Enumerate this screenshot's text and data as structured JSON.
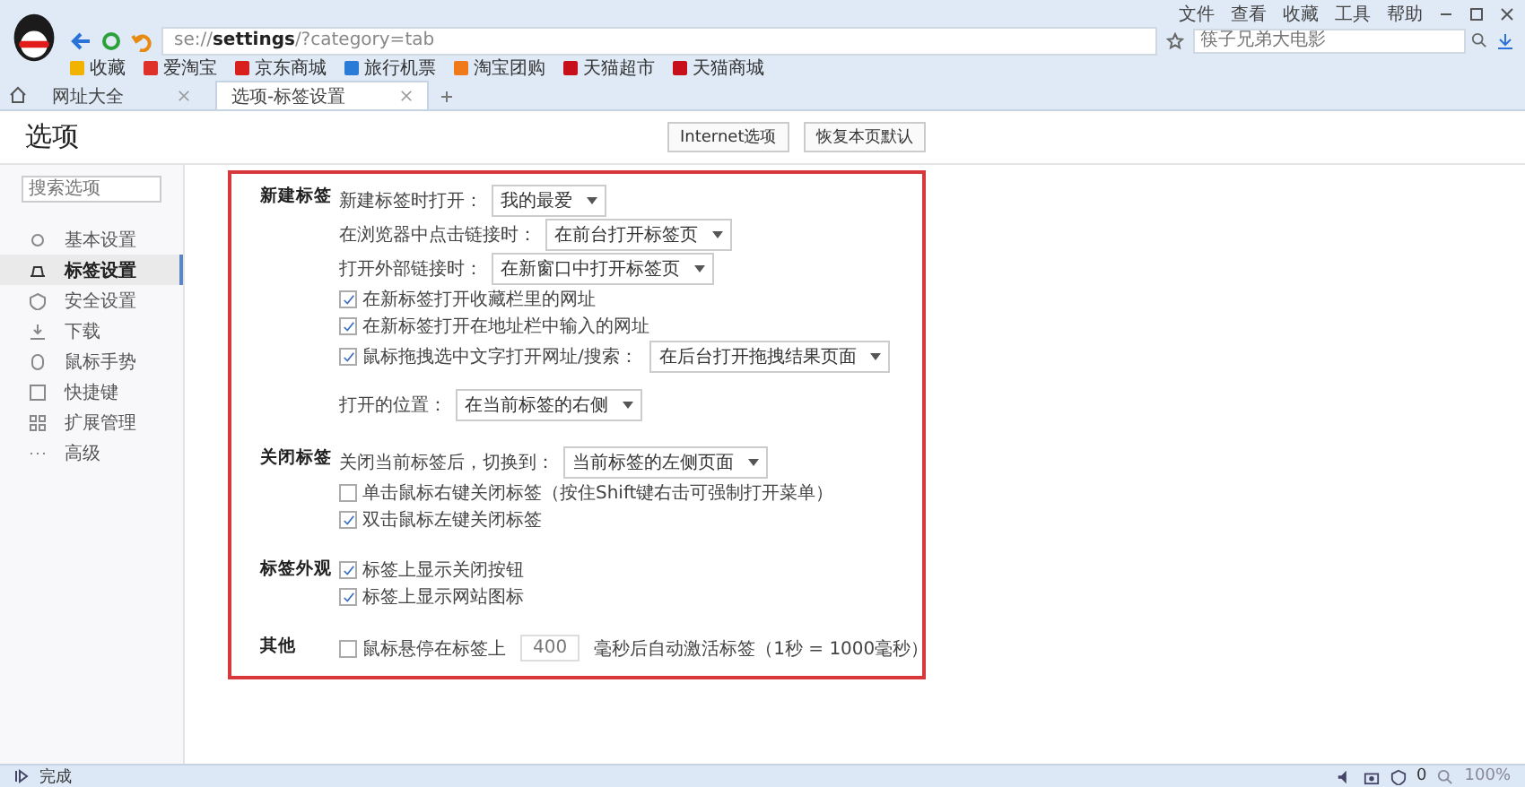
{
  "browser": {
    "menu": [
      "文件",
      "查看",
      "收藏",
      "工具",
      "帮助"
    ],
    "address": "se://**settings**/?category=tab",
    "search": {
      "placeholder": "筷子兄弟大电影"
    },
    "bookmarks": [
      {
        "label": "收藏",
        "color": "#f2b200"
      },
      {
        "label": "爱淘宝",
        "color": "#e0302a"
      },
      {
        "label": "京东商城",
        "color": "#d8201c"
      },
      {
        "label": "旅行机票",
        "color": "#2a7ad8"
      },
      {
        "label": "淘宝团购",
        "color": "#f07a1a"
      },
      {
        "label": "天猫超市",
        "color": "#c8101a"
      },
      {
        "label": "天猫商城",
        "color": "#c8101a"
      }
    ],
    "tabs": [
      {
        "label": "网址大全",
        "selected": false
      },
      {
        "label": "选项-标签设置",
        "selected": true
      }
    ]
  },
  "page": {
    "title": "选项",
    "buttons": [
      "Internet选项",
      "恢复本页默认"
    ],
    "sidebar": {
      "search": {
        "placeholder": "搜索选项"
      },
      "items": [
        {
          "label": "基本设置",
          "selected": false
        },
        {
          "label": "标签设置",
          "selected": true
        },
        {
          "label": "安全设置",
          "selected": false
        },
        {
          "label": "下载",
          "selected": false
        },
        {
          "label": "鼠标手势",
          "selected": false
        },
        {
          "label": "快捷键",
          "selected": false
        },
        {
          "label": "扩展管理",
          "selected": false
        },
        {
          "label": "高级",
          "selected": false
        }
      ]
    },
    "sections": [
      {
        "title": "新建标签",
        "rows": [
          {
            "kind": "select",
            "label": "新建标签时打开：",
            "value": "我的最爱"
          },
          {
            "kind": "select",
            "label": "在浏览器中点击链接时：",
            "value": "在前台打开标签页"
          },
          {
            "kind": "select",
            "label": "打开外部链接时：",
            "value": "在新窗口中打开标签页"
          },
          {
            "kind": "check",
            "label": "在新标签打开收藏栏里的网址",
            "checked": true
          },
          {
            "kind": "check",
            "label": "在新标签打开在地址栏中输入的网址",
            "checked": true
          },
          {
            "kind": "check_select",
            "label": "鼠标拖拽选中文字打开网址/搜索：",
            "checked": true,
            "value": "在后台打开拖拽结果页面"
          },
          {
            "kind": "select",
            "label": "打开的位置：",
            "value": "在当前标签的右侧"
          }
        ]
      },
      {
        "title": "关闭标签",
        "rows": [
          {
            "kind": "select",
            "label": "关闭当前标签后，切换到：",
            "value": "当前标签的左侧页面"
          },
          {
            "kind": "check",
            "label": "单击鼠标右键关闭标签（按住Shift键右击可强制打开菜单）",
            "checked": false
          },
          {
            "kind": "check",
            "label": "双击鼠标左键关闭标签",
            "checked": true
          }
        ]
      },
      {
        "title": "标签外观",
        "rows": [
          {
            "kind": "check",
            "label": "标签上显示关闭按钮",
            "checked": true
          },
          {
            "kind": "check",
            "label": "标签上显示网站图标",
            "checked": true
          }
        ]
      },
      {
        "title": "其他",
        "rows": [
          {
            "kind": "delay",
            "label": "鼠标悬停在标签上",
            "checked": false,
            "value": "400",
            "suffix": "毫秒后自动激活标签（1秒 = 1000毫秒）"
          }
        ]
      }
    ]
  },
  "status_bar": {
    "text": "完成",
    "count": "0",
    "zoom": "100%"
  }
}
